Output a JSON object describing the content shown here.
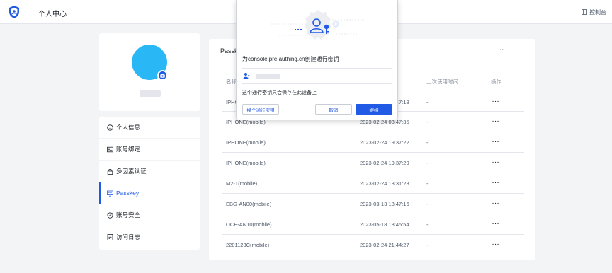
{
  "header": {
    "title": "个人中心",
    "console_label": "控制台"
  },
  "profile": {
    "avatar_color": "#2ab7f5",
    "accent": "#215ae5"
  },
  "sidebar": {
    "items": [
      {
        "label": "个人信息",
        "icon": "smile-icon"
      },
      {
        "label": "账号绑定",
        "icon": "id-card-icon"
      },
      {
        "label": "多因素认证",
        "icon": "lock-icon"
      },
      {
        "label": "Passkey",
        "icon": "monitor-icon",
        "active": true
      },
      {
        "label": "账号安全",
        "icon": "shield-icon"
      },
      {
        "label": "访问日志",
        "icon": "log-icon"
      }
    ]
  },
  "main": {
    "title": "Passkey",
    "more": "···",
    "columns": {
      "name": "名称",
      "last_used": "上次使用时间",
      "ops": "操作"
    },
    "rows": [
      {
        "name": "IPHONE(mobile)",
        "date": "2023-02-24 03:47:19",
        "last": "-",
        "op": "···"
      },
      {
        "name": "IPHONE(mobile)",
        "date": "2023-02-24 03:47:35",
        "last": "-",
        "op": "···"
      },
      {
        "name": "IPHONE(mobile)",
        "date": "2023-02-24 19:37:22",
        "last": "-",
        "op": "···"
      },
      {
        "name": "IPHONE(mobile)",
        "date": "2023-02-24 19:37:29",
        "last": "-",
        "op": "···"
      },
      {
        "name": "M2-1(mobile)",
        "date": "2023-02-24 18:31:28",
        "last": "-",
        "op": "···"
      },
      {
        "name": "EBG-AN00(mobile)",
        "date": "2023-03-13 18:47:16",
        "last": "-",
        "op": "···"
      },
      {
        "name": "OCE-AN10(mobile)",
        "date": "2023-05-18 18:45:54",
        "last": "-",
        "op": "···"
      },
      {
        "name": "2201123C(mobile)",
        "date": "2023-02-24 21:44:27",
        "last": "-",
        "op": "···"
      }
    ]
  },
  "dialog": {
    "title": "为console.pre.authing.cn创建通行密钥",
    "note": "这个通行密钥只会保存在此设备上",
    "change_button": "换个通行密钥",
    "cancel_button": "取消",
    "continue_button": "继续"
  }
}
